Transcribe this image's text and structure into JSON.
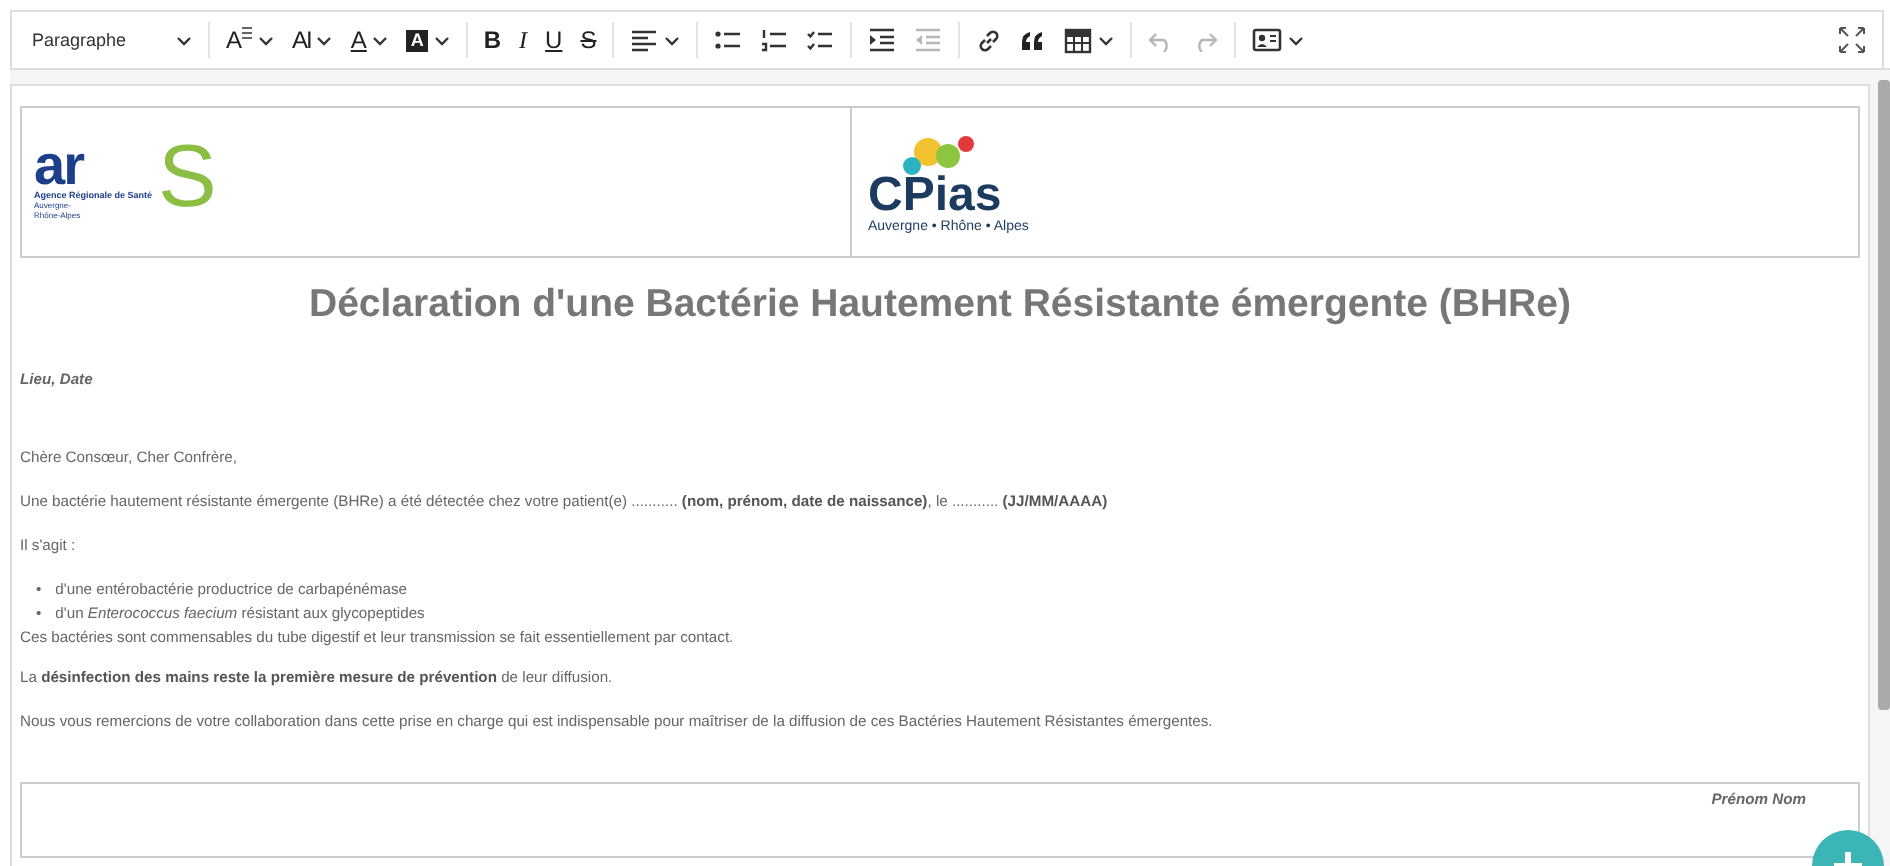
{
  "toolbar": {
    "items": [
      {
        "kind": "heading",
        "label": "Paragraphe",
        "dropdown": true,
        "disabled": false
      },
      {
        "kind": "fontsize",
        "label": "A",
        "dropdown": true,
        "disabled": false
      },
      {
        "kind": "fontfamily",
        "label": "AI",
        "dropdown": true,
        "disabled": false
      },
      {
        "kind": "fontcolor",
        "label": "A",
        "dropdown": true,
        "disabled": false
      },
      {
        "kind": "highlight",
        "label": "A",
        "dropdown": true,
        "disabled": false
      },
      {
        "kind": "bold",
        "label": "B",
        "dropdown": false,
        "disabled": false
      },
      {
        "kind": "italic",
        "label": "I",
        "dropdown": false,
        "disabled": false
      },
      {
        "kind": "underline",
        "label": "U",
        "dropdown": false,
        "disabled": false
      },
      {
        "kind": "strike",
        "label": "S",
        "dropdown": false,
        "disabled": false
      },
      {
        "kind": "align",
        "dropdown": true,
        "disabled": false
      },
      {
        "kind": "bullets",
        "dropdown": false,
        "disabled": false
      },
      {
        "kind": "numbers",
        "dropdown": false,
        "disabled": false
      },
      {
        "kind": "todo",
        "dropdown": false,
        "disabled": false
      },
      {
        "kind": "indent",
        "dropdown": false,
        "disabled": false
      },
      {
        "kind": "outdent",
        "dropdown": false,
        "disabled": true
      },
      {
        "kind": "link",
        "dropdown": false,
        "disabled": false
      },
      {
        "kind": "quote",
        "dropdown": false,
        "disabled": false
      },
      {
        "kind": "table",
        "dropdown": true,
        "disabled": false
      },
      {
        "kind": "undo",
        "dropdown": false,
        "disabled": true
      },
      {
        "kind": "redo",
        "dropdown": false,
        "disabled": true
      },
      {
        "kind": "card",
        "dropdown": true,
        "disabled": false
      }
    ]
  },
  "document": {
    "logos": {
      "ars": {
        "letters": "ar",
        "big": "S",
        "agency": "Agence Régionale de Santé",
        "region": "Auvergne-\nRhône-Alpes"
      },
      "cpias": {
        "name": "CPias",
        "region": "Auvergne • Rhône • Alpes"
      }
    },
    "title": "Déclaration d'une Bactérie Hautement Résistante émergente (BHRe)",
    "blocks": [
      {
        "kind": "strong",
        "text": "Lieu, Date"
      },
      {
        "kind": "spacer"
      },
      {
        "kind": "para",
        "text": "Chère Consœur, Cher Confrère,"
      },
      {
        "kind": "para",
        "text": "Une bactérie hautement résistante émergente (BHRe) a été détectée chez votre patient(e) ........... **(nom, prénom, date de naissance)**, le ........... **(JJ/MM/AAAA)**"
      },
      {
        "kind": "para",
        "text": "Il s'agit :"
      },
      {
        "kind": "list",
        "marker": "•",
        "items": [
          "d'une entérobactérie productrice de carbapénémase",
          "d'un *Enterococcus faecium* résistant aux glycopeptides"
        ]
      },
      {
        "kind": "tight",
        "text": "Ces bactéries sont commensables du tube digestif et leur transmission se fait essentiellement par contact."
      },
      {
        "kind": "para",
        "text": "La **désinfection des mains reste la première mesure de prévention** de leur diffusion."
      },
      {
        "kind": "para",
        "text": "Nous vous remercions de votre collaboration dans cette prise en charge qui est indispensable pour maîtriser de la diffusion de ces Bactéries Hautement Résistantes émergentes."
      }
    ],
    "signature": "Prénom Nom"
  }
}
